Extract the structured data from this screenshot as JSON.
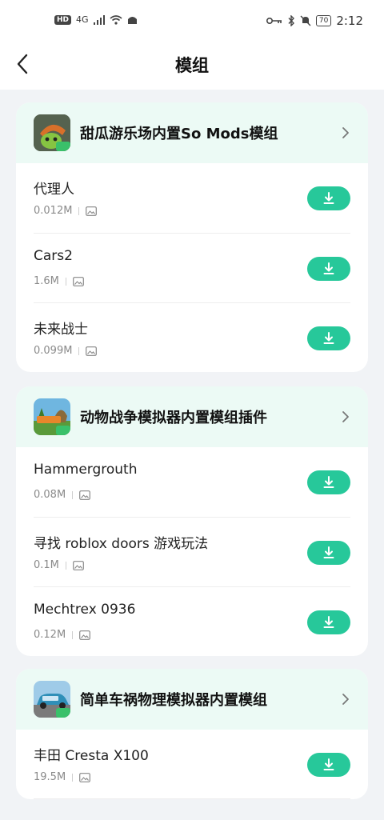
{
  "status_bar": {
    "hd": "HD",
    "network": "4G",
    "battery": "70",
    "time": "2:12"
  },
  "header": {
    "title": "模组"
  },
  "colors": {
    "accent": "#27c89a",
    "card_header_bg": "#ecfaf5",
    "page_bg": "#f1f3f6"
  },
  "groups": [
    {
      "title": "甜瓜游乐场内置So Mods模组",
      "icon": "melon-playground-app-icon",
      "items": [
        {
          "name": "代理人",
          "size": "0.012M"
        },
        {
          "name": "Cars2",
          "size": "1.6M"
        },
        {
          "name": "未来战士",
          "size": "0.099M"
        }
      ]
    },
    {
      "title": "动物战争模拟器内置模组插件",
      "icon": "animal-war-simulator-app-icon",
      "items": [
        {
          "name": "Hammergrouth",
          "size": "0.08M"
        },
        {
          "name": "寻找 roblox doors 游戏玩法",
          "size": "0.1M"
        },
        {
          "name": "Mechtrex 0936",
          "size": "0.12M"
        }
      ]
    },
    {
      "title": "简单车祸物理模拟器内置模组",
      "icon": "car-crash-simulator-app-icon",
      "items": [
        {
          "name": "丰田 Cresta X100",
          "size": "19.5M"
        }
      ]
    }
  ]
}
